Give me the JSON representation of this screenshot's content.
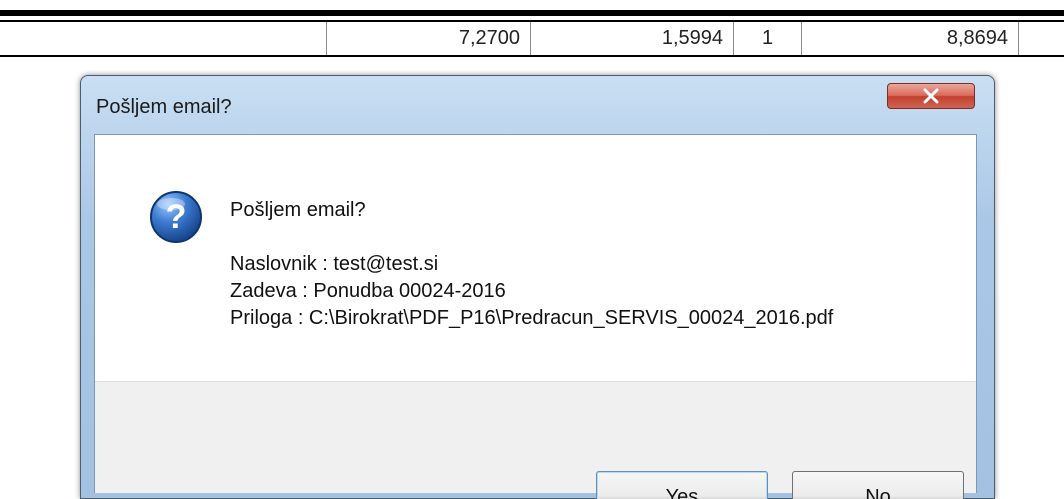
{
  "table": {
    "row": {
      "cell1": "7,2700",
      "cell2": "1,5994",
      "cell3": "1",
      "cell4": "8,8694"
    }
  },
  "dialog": {
    "title": "Pošljem email?",
    "close_icon": "close-icon",
    "question_icon": "question-icon",
    "message": {
      "heading": "Pošljem email?",
      "recipient": "Naslovnik : test@test.si",
      "subject": "Zadeva : Ponudba 00024-2016",
      "attachment": "Priloga : C:\\Birokrat\\PDF_P16\\Predracun_SERVIS_00024_2016.pdf"
    },
    "buttons": {
      "yes": "Yes",
      "no": "No"
    },
    "colors": {
      "title_bar": "#a9c7e6",
      "close_button": "#d96a59",
      "question_icon": "#2a5ea8"
    }
  }
}
